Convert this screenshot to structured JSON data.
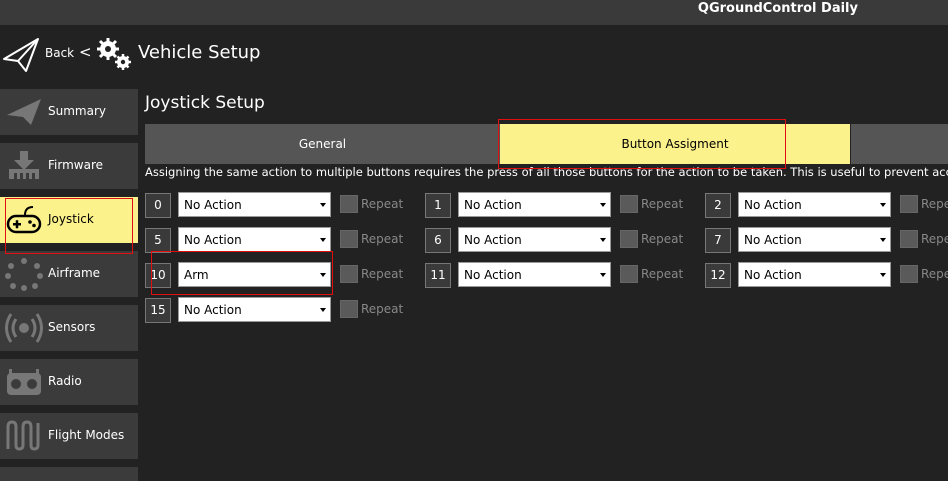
{
  "window": {
    "title": "QGroundControl Daily"
  },
  "header": {
    "back_label": "Back",
    "back_separator": "<",
    "title": "Vehicle Setup"
  },
  "sidebar": {
    "items": [
      {
        "label": "Summary",
        "icon": "paper-plane-icon",
        "active": false
      },
      {
        "label": "Firmware",
        "icon": "firmware-download-icon",
        "active": false
      },
      {
        "label": "Joystick",
        "icon": "gamepad-icon",
        "active": true
      },
      {
        "label": "Airframe",
        "icon": "airframe-icon",
        "active": false
      },
      {
        "label": "Sensors",
        "icon": "sensors-icon",
        "active": false
      },
      {
        "label": "Radio",
        "icon": "radio-icon",
        "active": false
      },
      {
        "label": "Flight Modes",
        "icon": "flight-modes-icon",
        "active": false
      }
    ]
  },
  "main": {
    "title": "Joystick Setup",
    "tabs": [
      {
        "label": "General",
        "active": false
      },
      {
        "label": "Button Assigment",
        "active": true
      }
    ],
    "hint": "Assigning the same action to multiple buttons requires the press of all those buttons for the action to be taken. This is useful to prevent accident",
    "repeat_label": "Repeat",
    "buttons": [
      {
        "number": "0",
        "action": "No Action"
      },
      {
        "number": "1",
        "action": "No Action"
      },
      {
        "number": "2",
        "action": "No Action"
      },
      {
        "number": "5",
        "action": "No Action"
      },
      {
        "number": "6",
        "action": "No Action"
      },
      {
        "number": "7",
        "action": "No Action"
      },
      {
        "number": "10",
        "action": "Arm"
      },
      {
        "number": "11",
        "action": "No Action"
      },
      {
        "number": "12",
        "action": "No Action"
      },
      {
        "number": "15",
        "action": "No Action"
      }
    ]
  },
  "colors": {
    "accent": "#fcf28c",
    "highlight": "#e11010",
    "panel": "#3b3b3b",
    "background": "#222222"
  }
}
